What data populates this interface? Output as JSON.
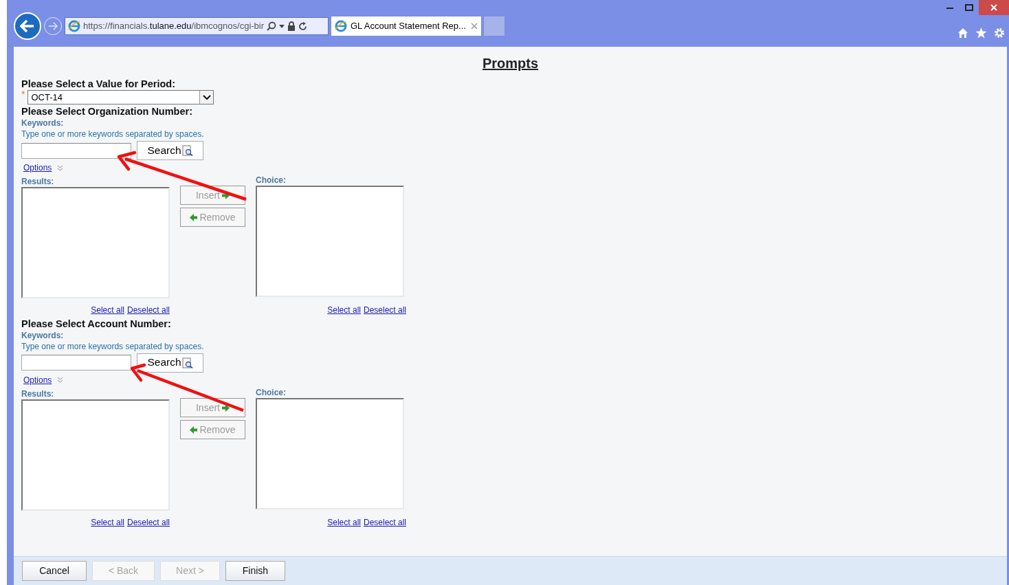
{
  "browser": {
    "address": "https://financials.**tulane.edu**/ibmcognos/cgi-bir",
    "tab_title": "GL Account Statement Rep..."
  },
  "title": "Prompts",
  "period": {
    "label": "Please Select a Value for Period:",
    "required": true,
    "required_mark": "*",
    "value": "OCT-14"
  },
  "pickers": [
    {
      "label": "Please Select Organization Number:",
      "keywords_label": "Keywords:",
      "hint": "Type one or more keywords separated by spaces.",
      "search_button": "Search",
      "options_link": "Options",
      "results_label": "Results:",
      "choice_label": "Choice:",
      "insert": {
        "label": "Insert",
        "disabled": true
      },
      "remove": {
        "label": "Remove",
        "disabled": true
      },
      "results_links": [
        "Select all",
        "Deselect all"
      ],
      "choice_links": [
        "Select all",
        "Deselect all"
      ]
    },
    {
      "label": "Please Select Account Number:",
      "keywords_label": "Keywords:",
      "hint": "Type one or more keywords separated by spaces.",
      "search_button": "Search",
      "options_link": "Options",
      "results_label": "Results:",
      "choice_label": "Choice:",
      "insert": {
        "label": "Insert",
        "disabled": true
      },
      "remove": {
        "label": "Remove",
        "disabled": true
      },
      "results_links": [
        "Select all",
        "Deselect all"
      ],
      "choice_links": [
        "Select all",
        "Deselect all"
      ]
    }
  ],
  "footer_buttons": [
    {
      "label": "Cancel",
      "disabled": false
    },
    {
      "label": "< Back",
      "disabled": true
    },
    {
      "label": "Next >",
      "disabled": true
    },
    {
      "label": "Finish",
      "disabled": false
    }
  ]
}
